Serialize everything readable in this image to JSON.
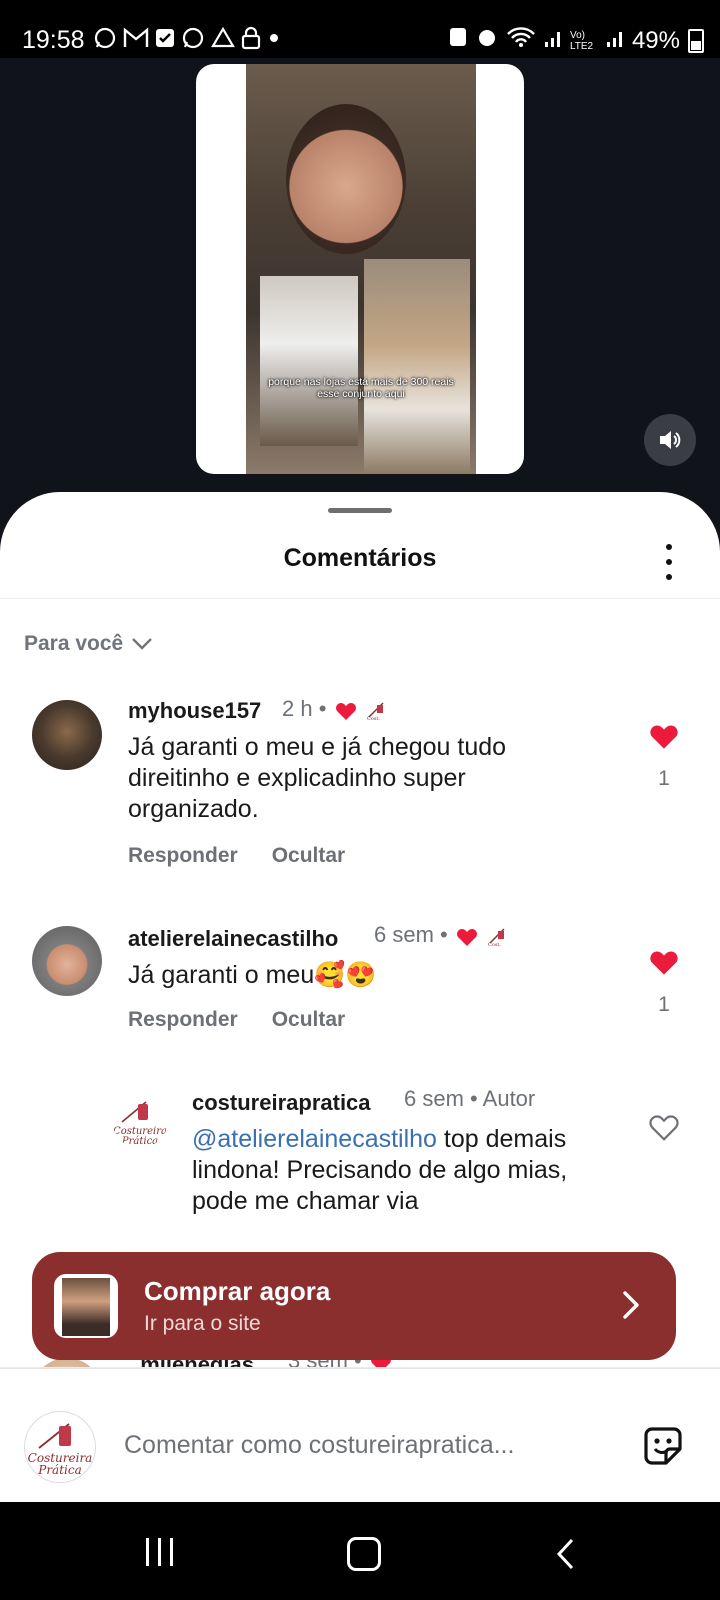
{
  "status_bar": {
    "time": "19:58",
    "battery": "49%",
    "network": "Vo) LTE2"
  },
  "video": {
    "subtitle": "porque nas lojas está mais de 300 reais esse conjunto aqui"
  },
  "sheet": {
    "title": "Comentários",
    "filter_label": "Para você"
  },
  "comments": [
    {
      "username": "myhouse157",
      "time": "2 h",
      "text": "Já garanti o meu e já chegou tudo direitinho e explicadinho super organizado.",
      "reply_label": "Responder",
      "hide_label": "Ocultar",
      "likes": "1",
      "liked": true
    },
    {
      "username": "atelierelainecastilho",
      "time": "6 sem",
      "text": "Já garanti o meu🥰😍",
      "reply_label": "Responder",
      "hide_label": "Ocultar",
      "likes": "1",
      "liked": true
    },
    {
      "username": "costureirapratica",
      "time": "6 sem",
      "author_badge": "Autor",
      "mention": "@atelierelainecastilho",
      "text": " top demais lindona! Precisando de algo mias, pode me chamar via",
      "liked": false
    },
    {
      "username": "_milenedias_",
      "time": "3 sem"
    }
  ],
  "cta": {
    "title": "Comprar agora",
    "subtitle": "Ir para o site"
  },
  "input": {
    "placeholder": "Comentar como costureirapratica..."
  },
  "brand": {
    "logo_text_1": "Costureira",
    "logo_text_2": "Prática",
    "accent_color": "#8b2e2e",
    "heart_color": "#ed1b3b"
  }
}
